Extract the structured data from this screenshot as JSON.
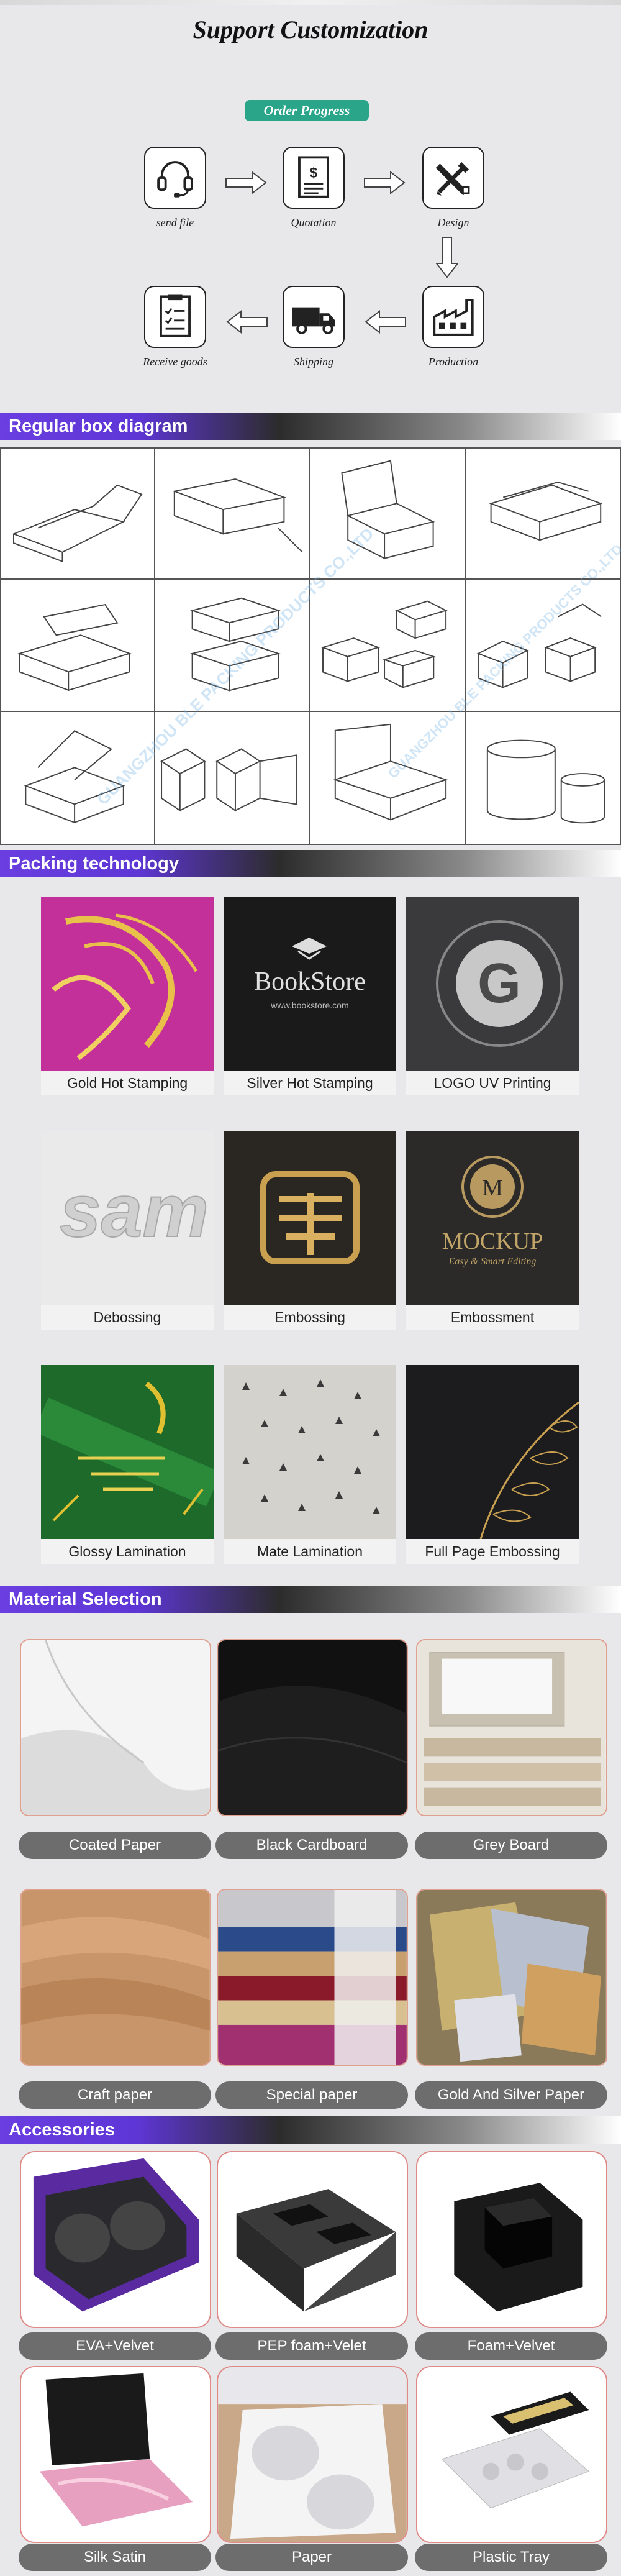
{
  "title": "Support Customization",
  "order_progress": {
    "label": "Order Progress",
    "steps": [
      {
        "label": "send file",
        "icon": "headset-icon"
      },
      {
        "label": "Quotation",
        "icon": "dollar-document-icon"
      },
      {
        "label": "Design",
        "icon": "design-tools-icon"
      },
      {
        "label": "Production",
        "icon": "factory-icon"
      },
      {
        "label": "Shipping",
        "icon": "truck-icon"
      },
      {
        "label": "Receive goods",
        "icon": "checklist-document-icon"
      }
    ]
  },
  "sections": {
    "box_diagram": "Regular box diagram",
    "packing": "Packing technology",
    "material": "Material Selection",
    "accessories": "Accessories"
  },
  "watermark": "GUANGZHOU BLE PACKING PRODUCTS CO.,LTD",
  "packing_items": [
    "Gold Hot Stamping",
    "Silver Hot Stamping",
    "LOGO UV Printing",
    "Debossing",
    "Embossing",
    "Embossment",
    "Glossy Lamination",
    "Mate Lamination",
    "Full Page Embossing"
  ],
  "packing_image_text": {
    "bookstore": "BookStore",
    "bookstore_url": "www.bookstore.com",
    "logo_letter": "G",
    "debossing": "sam",
    "mockup": "MOCKUP",
    "mockup_sub": "Easy & Smart Editing",
    "m_letter": "M"
  },
  "materials": [
    "Coated Paper",
    "Black Cardboard",
    "Grey Board",
    "Craft paper",
    "Special paper",
    "Gold And Silver Paper"
  ],
  "accessories": [
    "EVA+Velvet",
    "PEP foam+Velet",
    "Foam+Velvet",
    "Silk Satin",
    "Paper",
    "Plastic Tray"
  ],
  "colors": {
    "accent": "#2aa58a",
    "banner": "#5e36d6",
    "caption_bg": "#6d6d6d"
  }
}
